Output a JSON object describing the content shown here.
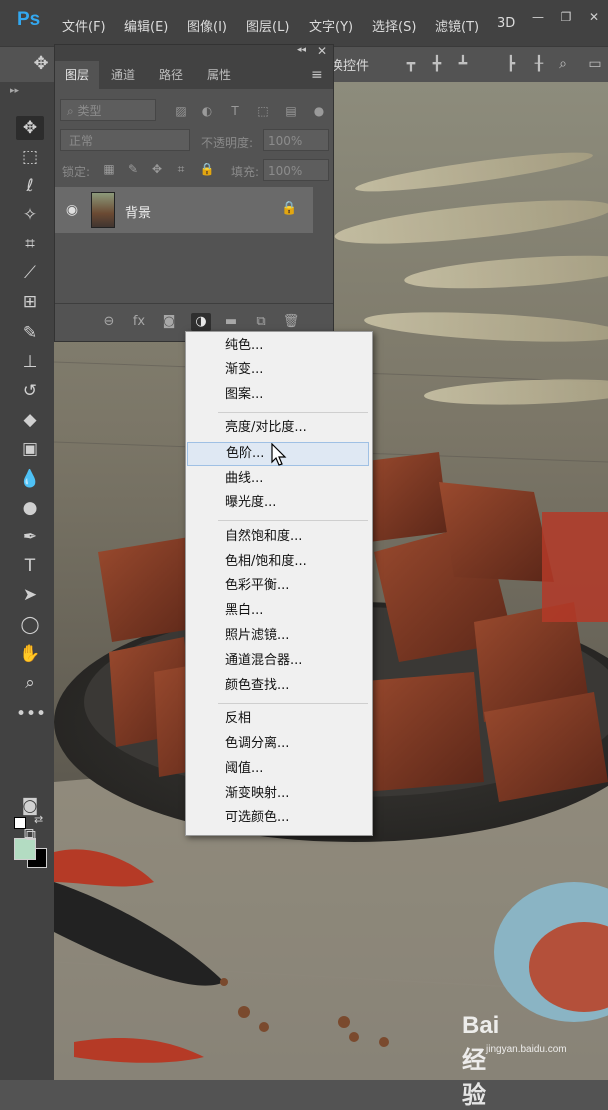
{
  "app": {
    "logo": "Ps"
  },
  "menubar": {
    "items": [
      "文件(F)",
      "编辑(E)",
      "图像(I)",
      "图层(L)",
      "文字(Y)",
      "选择(S)",
      "滤镜(T)",
      "3D"
    ],
    "window_buttons": {
      "minimize": "—",
      "restore": "❐",
      "close": "✕"
    }
  },
  "options_bar": {
    "transform_label": "换控件"
  },
  "layers_panel": {
    "tabs": [
      "图层",
      "通道",
      "路径",
      "属性"
    ],
    "active_tab": "图层",
    "filter_kind": "类型",
    "blend_mode": "正常",
    "opacity_label": "不透明度:",
    "opacity_value": "100%",
    "lock_label": "锁定:",
    "fill_label": "填充:",
    "fill_value": "100%",
    "layer": {
      "name": "背景",
      "visible": true,
      "locked": true
    }
  },
  "adjustment_menu": {
    "groups": [
      [
        "纯色...",
        "渐变...",
        "图案..."
      ],
      [
        "亮度/对比度...",
        "色阶...",
        "曲线...",
        "曝光度..."
      ],
      [
        "自然饱和度...",
        "色相/饱和度...",
        "色彩平衡...",
        "黑白...",
        "照片滤镜...",
        "通道混合器...",
        "颜色查找..."
      ],
      [
        "反相",
        "色调分离...",
        "阈值...",
        "渐变映射...",
        "可选颜色..."
      ]
    ],
    "hovered": "色阶..."
  },
  "toolbar": {
    "foreground_color": "#b3dcc2",
    "background_color": "#000000",
    "tools": [
      "move-icon",
      "marquee-icon",
      "lasso-icon",
      "magic-wand-icon",
      "crop-icon",
      "eyedropper-icon",
      "healing-icon",
      "brush-icon",
      "stamp-icon",
      "history-brush-icon",
      "eraser-icon",
      "gradient-icon",
      "blur-icon",
      "dodge-icon",
      "pen-icon",
      "type-icon",
      "path-select-icon",
      "ellipse-icon",
      "hand-icon",
      "zoom-icon",
      "more-icon"
    ]
  },
  "watermark": {
    "brand": "Bai 经验",
    "url": "jingyan.baidu.com"
  }
}
